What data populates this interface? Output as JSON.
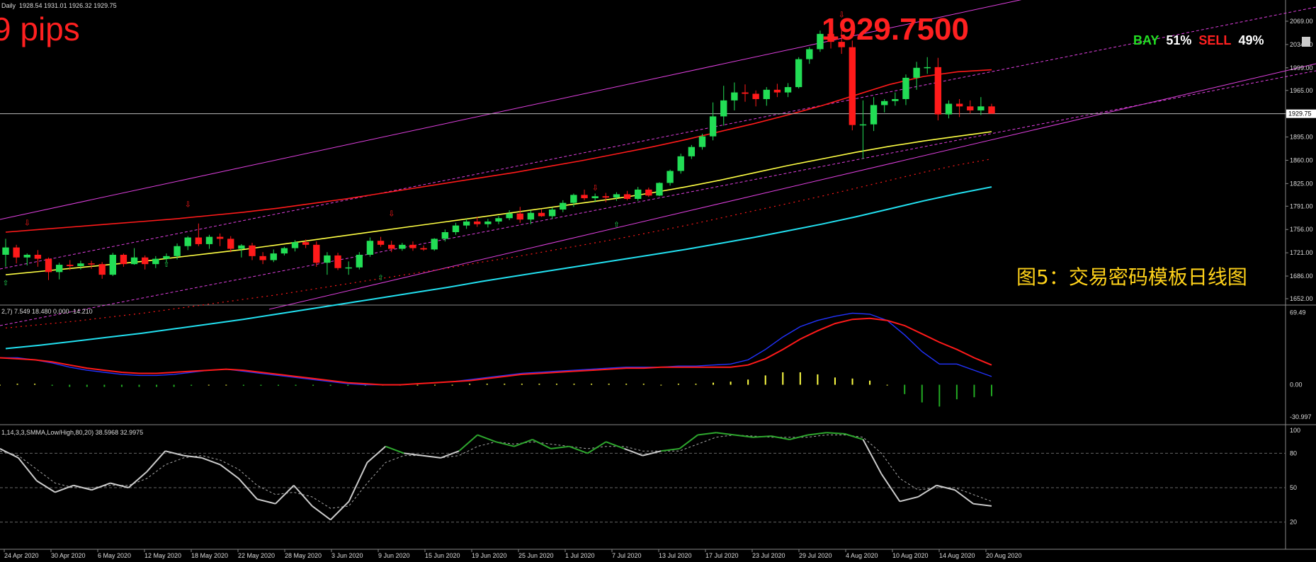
{
  "header": {
    "ohlc_text": "Daily  1928.54 1931.01 1926.32 1929.75",
    "pips_text": "9 pips",
    "big_price": "1929.7500",
    "bay_label": "BAY",
    "bay_pct": "51%",
    "sell_label": "SELL",
    "sell_pct": "49%",
    "caption": "图5：交易密码模板日线图",
    "price_tag": "1929.75"
  },
  "colors": {
    "bull": "#22dd55",
    "bear": "#ff1a1a",
    "ma_red": "#ff1a1a",
    "ma_yellow": "#ffff44",
    "ma_cyan": "#22e0f0",
    "channel": "#e040e0",
    "macd_blue": "#2233ff",
    "macd_red": "#ff1a1a",
    "stoch_main": "#cccccc",
    "stoch_signal": "#aaaaaa"
  },
  "indicators": {
    "macd_label": "2,7) 7.549 18.480 0.000 -14.210",
    "stoch_label": "1,14,3,3,SMMA,Low/High,80,20) 38.5968 32.9975"
  },
  "chart_data": [
    {
      "type": "candlestick",
      "y_ticks": [
        "2069.00",
        "2034.00",
        "1999.00",
        "1965.00",
        "1930.00",
        "1895.00",
        "1860.00",
        "1825.00",
        "1791.00",
        "1756.00",
        "1721.00",
        "1686.00",
        "1652.00"
      ],
      "ylim": [
        1652,
        2080
      ],
      "x_ticks": [
        "24 Apr 2020",
        "30 Apr 2020",
        "6 May 2020",
        "12 May 2020",
        "18 May 2020",
        "22 May 2020",
        "28 May 2020",
        "3 Jun 2020",
        "9 Jun 2020",
        "15 Jun 2020",
        "19 Jun 2020",
        "25 Jun 2020",
        "1 Jul 2020",
        "7 Jul 2020",
        "13 Jul 2020",
        "17 Jul 2020",
        "23 Jul 2020",
        "29 Jul 2020",
        "4 Aug 2020",
        "10 Aug 2020",
        "14 Aug 2020",
        "20 Aug 2020"
      ],
      "candles": [
        {
          "o": 1718,
          "h": 1742,
          "l": 1700,
          "c": 1729
        },
        {
          "o": 1729,
          "h": 1733,
          "l": 1705,
          "c": 1714
        },
        {
          "o": 1714,
          "h": 1720,
          "l": 1702,
          "c": 1718
        },
        {
          "o": 1718,
          "h": 1725,
          "l": 1700,
          "c": 1712
        },
        {
          "o": 1712,
          "h": 1714,
          "l": 1680,
          "c": 1692
        },
        {
          "o": 1692,
          "h": 1706,
          "l": 1681,
          "c": 1703
        },
        {
          "o": 1703,
          "h": 1710,
          "l": 1695,
          "c": 1701
        },
        {
          "o": 1701,
          "h": 1709,
          "l": 1696,
          "c": 1705
        },
        {
          "o": 1705,
          "h": 1709,
          "l": 1697,
          "c": 1704
        },
        {
          "o": 1704,
          "h": 1707,
          "l": 1682,
          "c": 1688
        },
        {
          "o": 1688,
          "h": 1721,
          "l": 1686,
          "c": 1718
        },
        {
          "o": 1718,
          "h": 1720,
          "l": 1700,
          "c": 1704
        },
        {
          "o": 1704,
          "h": 1728,
          "l": 1703,
          "c": 1714
        },
        {
          "o": 1714,
          "h": 1717,
          "l": 1696,
          "c": 1704
        },
        {
          "o": 1704,
          "h": 1716,
          "l": 1698,
          "c": 1712
        },
        {
          "o": 1712,
          "h": 1720,
          "l": 1707,
          "c": 1716
        },
        {
          "o": 1716,
          "h": 1735,
          "l": 1711,
          "c": 1731
        },
        {
          "o": 1731,
          "h": 1746,
          "l": 1725,
          "c": 1744
        },
        {
          "o": 1744,
          "h": 1765,
          "l": 1731,
          "c": 1734
        },
        {
          "o": 1734,
          "h": 1748,
          "l": 1727,
          "c": 1745
        },
        {
          "o": 1745,
          "h": 1750,
          "l": 1731,
          "c": 1742
        },
        {
          "o": 1742,
          "h": 1746,
          "l": 1722,
          "c": 1727
        },
        {
          "o": 1727,
          "h": 1734,
          "l": 1714,
          "c": 1732
        },
        {
          "o": 1732,
          "h": 1736,
          "l": 1710,
          "c": 1716
        },
        {
          "o": 1716,
          "h": 1722,
          "l": 1704,
          "c": 1710
        },
        {
          "o": 1710,
          "h": 1726,
          "l": 1707,
          "c": 1720
        },
        {
          "o": 1720,
          "h": 1730,
          "l": 1717,
          "c": 1728
        },
        {
          "o": 1728,
          "h": 1740,
          "l": 1723,
          "c": 1737
        },
        {
          "o": 1737,
          "h": 1741,
          "l": 1728,
          "c": 1733
        },
        {
          "o": 1733,
          "h": 1738,
          "l": 1700,
          "c": 1706
        },
        {
          "o": 1706,
          "h": 1722,
          "l": 1688,
          "c": 1717
        },
        {
          "o": 1717,
          "h": 1721,
          "l": 1695,
          "c": 1698
        },
        {
          "o": 1698,
          "h": 1708,
          "l": 1688,
          "c": 1699
        },
        {
          "o": 1699,
          "h": 1722,
          "l": 1696,
          "c": 1718
        },
        {
          "o": 1718,
          "h": 1744,
          "l": 1715,
          "c": 1739
        },
        {
          "o": 1739,
          "h": 1745,
          "l": 1730,
          "c": 1733
        },
        {
          "o": 1733,
          "h": 1739,
          "l": 1722,
          "c": 1727
        },
        {
          "o": 1727,
          "h": 1736,
          "l": 1724,
          "c": 1733
        },
        {
          "o": 1733,
          "h": 1738,
          "l": 1724,
          "c": 1728
        },
        {
          "o": 1728,
          "h": 1732,
          "l": 1724,
          "c": 1726
        },
        {
          "o": 1726,
          "h": 1743,
          "l": 1724,
          "c": 1742
        },
        {
          "o": 1742,
          "h": 1756,
          "l": 1738,
          "c": 1752
        },
        {
          "o": 1752,
          "h": 1766,
          "l": 1748,
          "c": 1762
        },
        {
          "o": 1762,
          "h": 1772,
          "l": 1757,
          "c": 1768
        },
        {
          "o": 1768,
          "h": 1775,
          "l": 1760,
          "c": 1764
        },
        {
          "o": 1764,
          "h": 1772,
          "l": 1759,
          "c": 1768
        },
        {
          "o": 1768,
          "h": 1776,
          "l": 1764,
          "c": 1773
        },
        {
          "o": 1773,
          "h": 1785,
          "l": 1770,
          "c": 1780
        },
        {
          "o": 1780,
          "h": 1790,
          "l": 1766,
          "c": 1771
        },
        {
          "o": 1771,
          "h": 1785,
          "l": 1764,
          "c": 1781
        },
        {
          "o": 1781,
          "h": 1786,
          "l": 1775,
          "c": 1776
        },
        {
          "o": 1776,
          "h": 1789,
          "l": 1772,
          "c": 1786
        },
        {
          "o": 1786,
          "h": 1800,
          "l": 1782,
          "c": 1796
        },
        {
          "o": 1796,
          "h": 1810,
          "l": 1790,
          "c": 1808
        },
        {
          "o": 1808,
          "h": 1816,
          "l": 1800,
          "c": 1803
        },
        {
          "o": 1803,
          "h": 1810,
          "l": 1797,
          "c": 1806
        },
        {
          "o": 1806,
          "h": 1811,
          "l": 1797,
          "c": 1804
        },
        {
          "o": 1804,
          "h": 1812,
          "l": 1799,
          "c": 1809
        },
        {
          "o": 1809,
          "h": 1814,
          "l": 1800,
          "c": 1802
        },
        {
          "o": 1802,
          "h": 1820,
          "l": 1799,
          "c": 1816
        },
        {
          "o": 1816,
          "h": 1819,
          "l": 1805,
          "c": 1807
        },
        {
          "o": 1807,
          "h": 1827,
          "l": 1806,
          "c": 1826
        },
        {
          "o": 1826,
          "h": 1846,
          "l": 1822,
          "c": 1844
        },
        {
          "o": 1844,
          "h": 1870,
          "l": 1840,
          "c": 1866
        },
        {
          "o": 1866,
          "h": 1883,
          "l": 1862,
          "c": 1880
        },
        {
          "o": 1880,
          "h": 1900,
          "l": 1876,
          "c": 1896
        },
        {
          "o": 1896,
          "h": 1947,
          "l": 1890,
          "c": 1926
        },
        {
          "o": 1926,
          "h": 1972,
          "l": 1912,
          "c": 1950
        },
        {
          "o": 1950,
          "h": 1977,
          "l": 1935,
          "c": 1962
        },
        {
          "o": 1962,
          "h": 1974,
          "l": 1948,
          "c": 1960
        },
        {
          "o": 1960,
          "h": 1965,
          "l": 1941,
          "c": 1952
        },
        {
          "o": 1952,
          "h": 1970,
          "l": 1942,
          "c": 1966
        },
        {
          "o": 1966,
          "h": 1975,
          "l": 1955,
          "c": 1962
        },
        {
          "o": 1962,
          "h": 1976,
          "l": 1955,
          "c": 1970
        },
        {
          "o": 1970,
          "h": 2015,
          "l": 1968,
          "c": 2012
        },
        {
          "o": 2012,
          "h": 2030,
          "l": 2005,
          "c": 2027
        },
        {
          "o": 2027,
          "h": 2055,
          "l": 2023,
          "c": 2050
        },
        {
          "o": 2050,
          "h": 2069,
          "l": 2028,
          "c": 2038
        },
        {
          "o": 2038,
          "h": 2058,
          "l": 2020,
          "c": 2030
        },
        {
          "o": 2030,
          "h": 2040,
          "l": 1905,
          "c": 1913
        },
        {
          "o": 1913,
          "h": 1950,
          "l": 1862,
          "c": 1914
        },
        {
          "o": 1914,
          "h": 1955,
          "l": 1904,
          "c": 1943
        },
        {
          "o": 1943,
          "h": 1952,
          "l": 1932,
          "c": 1949
        },
        {
          "o": 1949,
          "h": 1962,
          "l": 1942,
          "c": 1952
        },
        {
          "o": 1952,
          "h": 1989,
          "l": 1943,
          "c": 1984
        },
        {
          "o": 1984,
          "h": 2008,
          "l": 1966,
          "c": 1999
        },
        {
          "o": 1999,
          "h": 2015,
          "l": 1990,
          "c": 2000
        },
        {
          "o": 2000,
          "h": 2014,
          "l": 1920,
          "c": 1929
        },
        {
          "o": 1929,
          "h": 1950,
          "l": 1923,
          "c": 1945
        },
        {
          "o": 1945,
          "h": 1952,
          "l": 1925,
          "c": 1941
        },
        {
          "o": 1941,
          "h": 1950,
          "l": 1930,
          "c": 1935
        },
        {
          "o": 1935,
          "h": 1955,
          "l": 1928,
          "c": 1941
        },
        {
          "o": 1941,
          "h": 1945,
          "l": 1930,
          "c": 1930
        }
      ],
      "ma_red": [
        1752,
        1756,
        1760,
        1764,
        1768,
        1772,
        1777,
        1782,
        1788,
        1795,
        1802,
        1810,
        1818,
        1826,
        1834,
        1842,
        1851,
        1860,
        1870,
        1880,
        1891,
        1903,
        1915,
        1928,
        1942,
        1958,
        1974,
        1986,
        1993,
        1996
      ],
      "ma_yellow": [
        1688,
        1693,
        1698,
        1703,
        1708,
        1714,
        1720,
        1726,
        1733,
        1740,
        1747,
        1754,
        1761,
        1768,
        1775,
        1782,
        1789,
        1796,
        1803,
        1811,
        1820,
        1830,
        1841,
        1852,
        1862,
        1872,
        1881,
        1889,
        1896,
        1903
      ],
      "ma_cyan": [
        1577,
        1582,
        1588,
        1594,
        1600,
        1607,
        1614,
        1621,
        1629,
        1637,
        1645,
        1653,
        1661,
        1669,
        1678,
        1686,
        1694,
        1702,
        1710,
        1718,
        1726,
        1735,
        1744,
        1754,
        1764,
        1775,
        1787,
        1799,
        1810,
        1820
      ],
      "ma_dotted": [
        1608,
        1613,
        1618,
        1624,
        1630,
        1637,
        1644,
        1651,
        1658,
        1666,
        1674,
        1682,
        1690,
        1698,
        1707,
        1715,
        1724,
        1733,
        1742,
        1752,
        1762,
        1773,
        1784,
        1795,
        1806,
        1818,
        1830,
        1842,
        1853,
        1862
      ]
    },
    {
      "type": "macd",
      "y_ticks": [
        "69.49",
        "0.00",
        "-30.997"
      ],
      "ylim": [
        -33,
        72
      ],
      "macd": [
        26,
        26,
        24,
        21,
        17,
        14,
        12,
        10,
        9,
        9,
        10,
        12,
        14,
        15,
        13,
        11,
        9,
        7,
        5,
        3,
        1,
        0,
        0,
        0,
        1,
        2,
        3,
        5,
        7,
        9,
        11,
        12,
        13,
        14,
        15,
        16,
        17,
        17,
        17,
        18,
        18,
        19,
        20,
        24,
        34,
        46,
        56,
        62,
        66,
        69,
        68,
        62,
        48,
        32,
        20,
        20,
        14,
        8
      ],
      "signal": [
        26,
        25,
        24,
        22,
        19,
        16,
        14,
        12,
        11,
        11,
        12,
        13,
        14,
        15,
        14,
        12,
        10,
        8,
        6,
        4,
        2,
        1,
        0,
        0,
        1,
        2,
        3,
        4,
        6,
        8,
        10,
        11,
        12,
        13,
        14,
        15,
        16,
        16,
        17,
        17,
        17,
        17,
        17,
        19,
        25,
        34,
        44,
        52,
        59,
        63,
        64,
        62,
        57,
        49,
        41,
        34,
        26,
        19
      ],
      "hist": [
        0,
        1,
        1,
        -1,
        -2,
        -2,
        -2,
        -2,
        -2,
        -2,
        -2,
        -1,
        0,
        0,
        -1,
        -1,
        -1,
        -1,
        -1,
        -1,
        -1,
        -1,
        0,
        0,
        0,
        0,
        0,
        1,
        1,
        1,
        1,
        1,
        1,
        1,
        1,
        1,
        1,
        1,
        0,
        1,
        1,
        2,
        3,
        5,
        9,
        12,
        12,
        10,
        7,
        6,
        4,
        0,
        -9,
        -17,
        -21,
        -14,
        -12,
        -11
      ]
    },
    {
      "type": "stochastic",
      "y_ticks": [
        "100",
        "80",
        "50",
        "20"
      ],
      "ylim": [
        0,
        100
      ],
      "main": [
        84,
        76,
        56,
        46,
        52,
        48,
        54,
        50,
        64,
        82,
        78,
        76,
        70,
        58,
        40,
        36,
        52,
        34,
        22,
        38,
        72,
        86,
        80,
        78,
        76,
        82,
        96,
        90,
        86,
        92,
        84,
        86,
        80,
        90,
        84,
        78,
        82,
        84,
        96,
        98,
        96,
        94,
        95,
        92,
        96,
        98,
        97,
        92,
        62,
        38,
        42,
        52,
        48,
        36,
        34
      ],
      "signal": [
        82,
        78,
        66,
        54,
        50,
        50,
        52,
        52,
        58,
        70,
        76,
        78,
        74,
        66,
        52,
        44,
        46,
        42,
        32,
        34,
        54,
        72,
        78,
        78,
        76,
        78,
        86,
        90,
        88,
        90,
        88,
        86,
        84,
        86,
        86,
        82,
        82,
        82,
        88,
        94,
        96,
        95,
        94,
        94,
        94,
        96,
        96,
        94,
        80,
        58,
        48,
        50,
        50,
        44,
        38
      ]
    }
  ]
}
